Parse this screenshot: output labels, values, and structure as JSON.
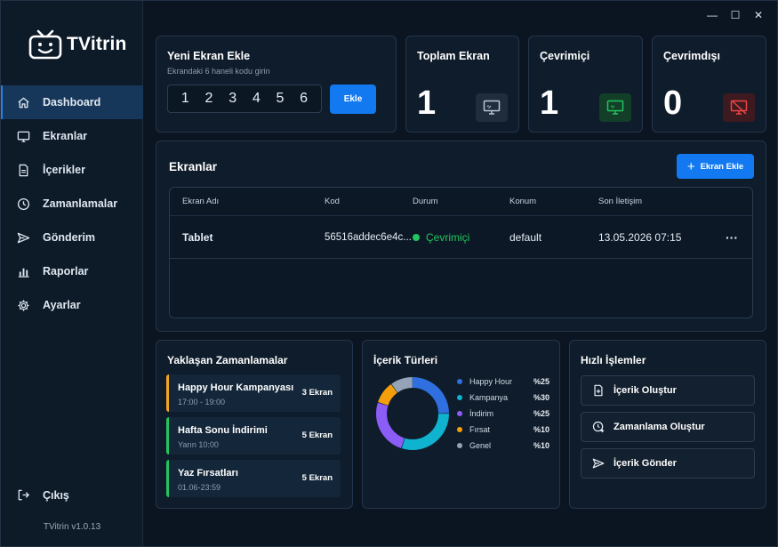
{
  "app": {
    "brand": "TVitrin",
    "version": "TVitrin v1.0.13"
  },
  "window_controls": {
    "minimize": "—",
    "maximize": "☐",
    "close": "✕"
  },
  "sidebar": {
    "items": [
      {
        "label": "Dashboard",
        "icon": "home-icon",
        "active": true
      },
      {
        "label": "Ekranlar",
        "icon": "monitor-icon"
      },
      {
        "label": "İçerikler",
        "icon": "document-icon"
      },
      {
        "label": "Zamanlamalar",
        "icon": "clock-icon"
      },
      {
        "label": "Gönderim",
        "icon": "send-icon"
      },
      {
        "label": "Raporlar",
        "icon": "bar-chart-icon"
      },
      {
        "label": "Ayarlar",
        "icon": "gear-icon"
      }
    ],
    "logout": "Çıkış"
  },
  "add_screen": {
    "title": "Yeni Ekran Ekle",
    "subtitle": "Ekrandaki 6 haneli kodu girin",
    "digits": [
      "1",
      "2",
      "3",
      "4",
      "5",
      "6"
    ],
    "button": "Ekle"
  },
  "stats": {
    "total": {
      "label": "Toplam Ekran",
      "value": "1",
      "icon": "monitor-icon",
      "color": "#8fa2b8"
    },
    "online": {
      "label": "Çevrimiçi",
      "value": "1",
      "icon": "monitor-online-icon",
      "color": "#22c55e"
    },
    "offline": {
      "label": "Çevrimdışı",
      "value": "0",
      "icon": "monitor-off-icon",
      "color": "#ef4444"
    }
  },
  "screens": {
    "title": "Ekranlar",
    "add_button": "Ekran Ekle",
    "columns": [
      "Ekran Adı",
      "Kod",
      "Durum",
      "Konum",
      "Son İletişim"
    ],
    "rows": [
      {
        "name": "Tablet",
        "code": "56516addec6e4c...",
        "status": "Çevrimiçi",
        "location": "default",
        "last_contact": "13.05.2026 07:15",
        "menu": "···"
      }
    ]
  },
  "upcoming": {
    "title": "Yaklaşan Zamanlamalar",
    "items": [
      {
        "title": "Happy Hour Kampanyası",
        "time": "17:00 - 19:00",
        "count": "3 Ekran",
        "color": "#f4a521"
      },
      {
        "title": "Hafta Sonu İndirimi",
        "time": "Yarın 10:00",
        "count": "5 Ekran",
        "color": "#22c55e"
      },
      {
        "title": "Yaz Fırsatları",
        "time": "01.06-23:59",
        "count": "5 Ekran",
        "color": "#22c55e"
      }
    ]
  },
  "content_types": {
    "title": "İçerik Türleri",
    "items": [
      {
        "label": "Happy Hour",
        "value": 25,
        "pct": "%25",
        "color": "#2f6fe0"
      },
      {
        "label": "Kampanya",
        "value": 30,
        "pct": "%30",
        "color": "#0fb3cf"
      },
      {
        "label": "İndirim",
        "value": 25,
        "pct": "%25",
        "color": "#8b5cf6"
      },
      {
        "label": "Fırsat",
        "value": 10,
        "pct": "%10",
        "color": "#f59e0b"
      },
      {
        "label": "Genel",
        "value": 10,
        "pct": "%10",
        "color": "#94a3b8"
      }
    ]
  },
  "quick_actions": {
    "title": "Hızlı İşlemler",
    "items": [
      {
        "label": "İçerik Oluştur",
        "icon": "add-document-icon"
      },
      {
        "label": "Zamanlama Oluştur",
        "icon": "add-clock-icon"
      },
      {
        "label": "İçerik Gönder",
        "icon": "send-icon"
      }
    ]
  }
}
